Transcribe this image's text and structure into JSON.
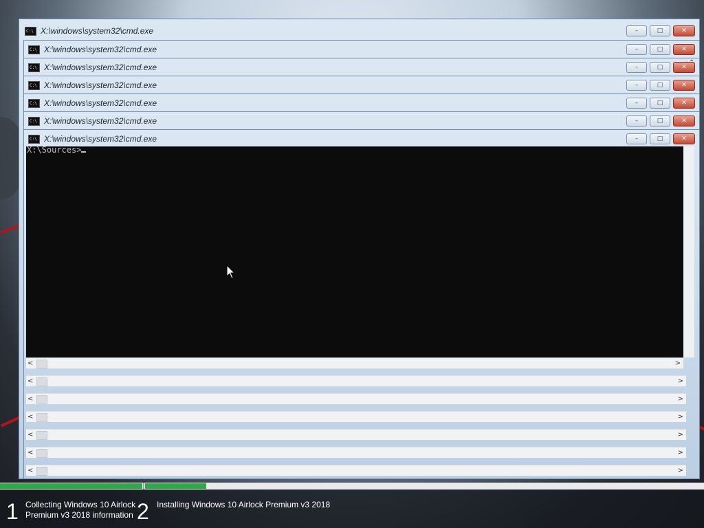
{
  "windows": [
    {
      "title": "X:\\windows\\system32\\cmd.exe"
    },
    {
      "title": "X:\\windows\\system32\\cmd.exe"
    },
    {
      "title": "X:\\windows\\system32\\cmd.exe"
    },
    {
      "title": "X:\\windows\\system32\\cmd.exe"
    },
    {
      "title": "X:\\windows\\system32\\cmd.exe"
    },
    {
      "title": "X:\\windows\\system32\\cmd.exe"
    },
    {
      "title": "X:\\windows\\system32\\cmd.exe"
    }
  ],
  "console": {
    "prompt": "X:\\Sources>",
    "background": "#0c0c0c",
    "text_color": "#c0c0c0"
  },
  "controls": {
    "minimize": "minimize-icon",
    "maximize": "maximize-icon",
    "close": "close-icon",
    "minimize_glyph": "–",
    "maximize_glyph": "□",
    "close_glyph": "✕"
  },
  "icons": {
    "cmd": "cmd-icon",
    "scroll_left": "chevron-left-icon",
    "scroll_right": "chevron-right-icon",
    "scroll_up": "chevron-up-icon",
    "cursor": "mouse-pointer-icon"
  },
  "setup_steps": [
    {
      "number": "1",
      "label": "Collecting Windows 10 Airlock Premium v3 2018 information",
      "progress": 1.0
    },
    {
      "number": "2",
      "label": "Installing Windows 10 Airlock Premium v3 2018",
      "progress": 0.11
    }
  ],
  "colors": {
    "progress": "#2fa84a",
    "close_button": "#c24a36"
  }
}
